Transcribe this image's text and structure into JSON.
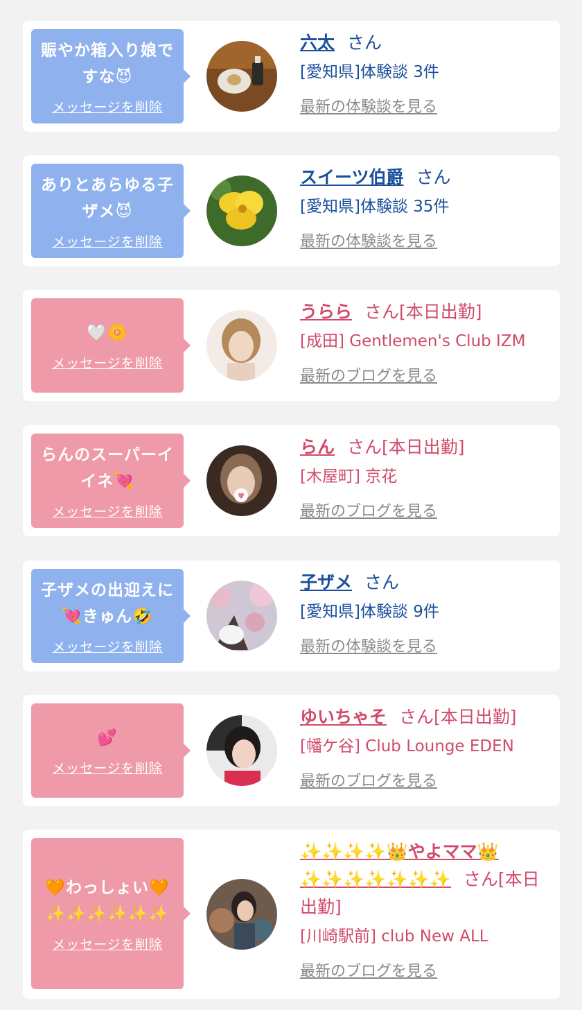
{
  "cards": [
    {
      "theme": "blue",
      "message": "賑やか箱入り娘ですな😈",
      "delete_label": "メッセージを削除",
      "name": "六太",
      "suffix": "さん",
      "sub": "[愛知県]体験談 3件",
      "more": "最新の体験談を見る",
      "avatar_icon": "cake-photo"
    },
    {
      "theme": "blue",
      "message": "ありとあらゆる子ザメ😈",
      "delete_label": "メッセージを削除",
      "name": "スイーツ伯爵",
      "suffix": "さん",
      "sub": "[愛知県]体験談 35件",
      "more": "最新の体験談を見る",
      "avatar_icon": "yellow-flower-photo"
    },
    {
      "theme": "pink",
      "message": "🤍🌼",
      "delete_label": "メッセージを削除",
      "name": "うらら",
      "suffix": "さん[本日出勤]",
      "sub": "[成田] Gentlemen's Club IZM",
      "more": "最新のブログを見る",
      "avatar_icon": "woman-portrait-photo"
    },
    {
      "theme": "pink",
      "message": "らんのスーパーイイネ💘",
      "delete_label": "メッセージを削除",
      "name": "らん",
      "suffix": "さん[本日出勤]",
      "sub": "[木屋町] 京花",
      "more": "最新のブログを見る",
      "avatar_icon": "woman-portrait-photo"
    },
    {
      "theme": "blue",
      "message": "子ザメの出迎えに💘きゅん🤣",
      "delete_label": "メッセージを削除",
      "name": "子ザメ",
      "suffix": "さん",
      "sub": "[愛知県]体験談 9件",
      "more": "最新の体験談を見る",
      "avatar_icon": "cherry-blossom-photo"
    },
    {
      "theme": "pink",
      "message": "💕",
      "delete_label": "メッセージを削除",
      "name": "ゆいちゃそ",
      "suffix": "さん[本日出勤]",
      "sub": "[幡ケ谷] Club Lounge EDEN",
      "more": "最新のブログを見る",
      "avatar_icon": "woman-portrait-photo"
    },
    {
      "theme": "pink",
      "message": "🧡わっしょい🧡✨✨✨✨✨✨",
      "delete_label": "メッセージを削除",
      "name": "✨✨✨✨👑やよママ👑✨✨✨✨✨✨✨",
      "suffix": "さん[本日出勤]",
      "sub": "[川崎駅前] club New ALL",
      "more": "最新のブログを見る",
      "avatar_icon": "woman-portrait-photo"
    }
  ],
  "colors": {
    "blue_bubble": "#8fb2ee",
    "pink_bubble": "#ef9aa8",
    "blue_text": "#1b4f9c",
    "pink_text": "#d14a6a",
    "link_gray": "#8a8a8a",
    "background": "#f2f2f2"
  }
}
